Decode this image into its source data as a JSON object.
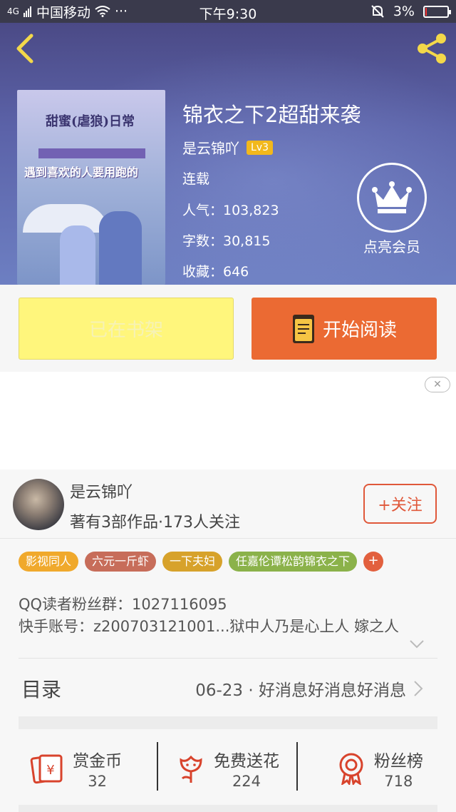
{
  "status_bar": {
    "carrier": "中国移动",
    "signal_label": "4G",
    "more": "···",
    "time": "下午9:30",
    "battery": "3%"
  },
  "book": {
    "title": "锦衣之下2超甜来袭",
    "author": "是云锦吖",
    "level": "Lv3",
    "status": "连载",
    "popularity": "人气：103,823",
    "word_count": "字数：30,815",
    "favorites": "收藏：646",
    "cover_text": {
      "line1": "甜蜜(虐狼)日常",
      "line2": "遇到喜欢的人要用跑的"
    }
  },
  "vip": {
    "label": "点亮会员"
  },
  "actions": {
    "shelf_label": "已在书架",
    "read_label": "开始阅读"
  },
  "ad": {
    "close": "✕"
  },
  "author_card": {
    "name": "是云锦吖",
    "works": "著有3部作品·173人关注",
    "follow_label": "+关注"
  },
  "tags": [
    {
      "label": "影视同人",
      "color": "#f0a92c"
    },
    {
      "label": "六元一斤虾",
      "color": "#c76d5a"
    },
    {
      "label": "一下夫妇",
      "color": "#d7a22b"
    },
    {
      "label": "任嘉伦谭松韵锦衣之下",
      "color": "#8bb24a"
    }
  ],
  "tag_more": "+",
  "intro": {
    "line1": "QQ读者粉丝群：1027116095",
    "line2": "快手账号：z200703121001...狱中人乃是心上人 嫁之人"
  },
  "toc": {
    "label": "目录",
    "latest": "06-23 · 好消息好消息好消息"
  },
  "stats": {
    "reward": {
      "label": "赏金币",
      "value": "32"
    },
    "flower": {
      "label": "免费送花",
      "value": "224"
    },
    "fans": {
      "label": "粉丝榜",
      "value": "718"
    }
  },
  "colors": {
    "accent": "#eb6a33",
    "shelf": "#fff67c",
    "level": "#f2b81c"
  }
}
